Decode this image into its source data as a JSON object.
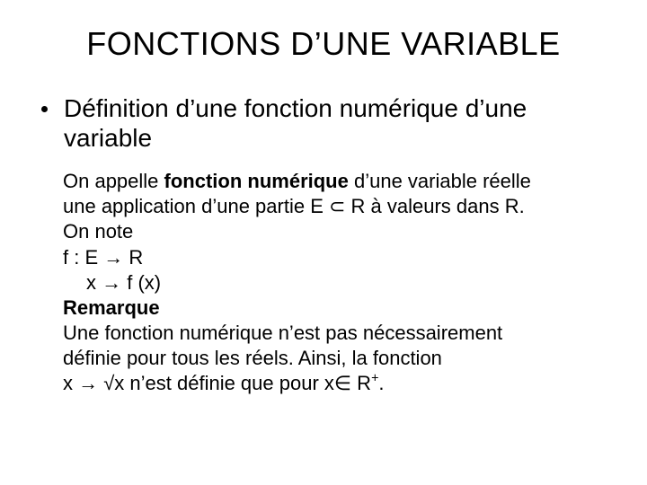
{
  "title": "FONCTIONS D’UNE VARIABLE",
  "bullet": "Définition d’une fonction numérique d’une variable",
  "body": {
    "p1_a": "On appelle ",
    "p1_b": "fonction numérique",
    "p1_c": " d’une variable réelle",
    "p2": "une application d’une partie E ⊂ R à valeurs dans R.",
    "p3": "On note",
    "p4": "f : E → R",
    "p5": "x → f (x)",
    "p6": "Remarque",
    "p7": "Une fonction numérique n’est pas nécessairement",
    "p8": "définie pour tous les réels. Ainsi, la fonction",
    "p9_a": "x → √x n’est définie que pour x∈ R",
    "p9_b": "+",
    "p9_c": "."
  }
}
